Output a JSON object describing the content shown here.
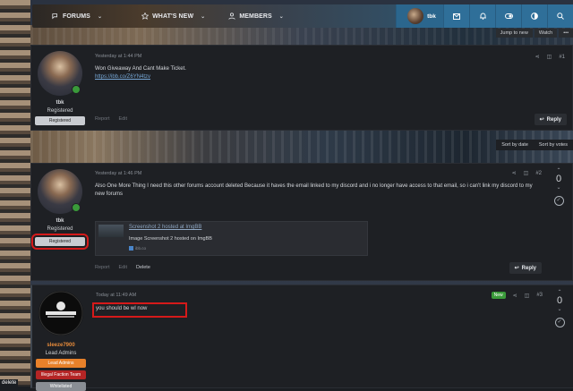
{
  "nav": {
    "items": [
      {
        "label": "FORUMS",
        "icon": "chat-bubbles-icon"
      },
      {
        "label": "WHAT'S NEW",
        "icon": "star-icon"
      },
      {
        "label": "MEMBERS",
        "icon": "person-icon"
      }
    ],
    "username": "tbk"
  },
  "thread_buttons": {
    "jump_to_new": "Jump to new",
    "watch": "Watch",
    "more": "•••"
  },
  "sort": {
    "by_date": "Sort by date",
    "by_votes": "Sort by votes"
  },
  "posts": [
    {
      "username": "tbk",
      "user_title": "Registered",
      "badges": [
        "Registered"
      ],
      "time": "Yesterday at 1:44 PM",
      "number": "#1",
      "text": "Won Giveaway And Cant Make Ticket.",
      "link": "https://ibb.co/Z6YN4tzv",
      "actions": [
        "Report",
        "Edit"
      ],
      "reply": "Reply"
    },
    {
      "username": "tbk",
      "user_title": "Registered",
      "badges": [
        "Registered"
      ],
      "time": "Yesterday at 1:46 PM",
      "number": "#2",
      "text": "Also One More Thing I need this other forums account deleted Because it haves the email linked to my discord and i no longer have access to that email, so i can't link my discord to my new forums",
      "embed": {
        "title": "Screenshot 2 hosted at ImgBB",
        "description": "Image Screenshot 2 hosted on ImgBB",
        "site": "ibb.co"
      },
      "actions": [
        "Report",
        "Edit",
        "Delete"
      ],
      "reply": "Reply",
      "votes": "0"
    },
    {
      "username": "sleeze7900",
      "user_title": "Lead Admins",
      "badges": [
        "Lead Admins",
        "Illegal Faction Team",
        "Whitelisted"
      ],
      "time": "Today at 11:49 AM",
      "number": "#3",
      "new_label": "New",
      "text": "you should be wl now",
      "votes": "0"
    }
  ],
  "footer_label": "delete",
  "colors": {
    "accent": "#2f6f99",
    "highlight_box": "#d51a1a",
    "online": "#3a9a3a",
    "badge_lead_admins": "#e8812a",
    "badge_illegal_faction": "#b42525",
    "badge_whitelisted": "#8a8e94",
    "sleeze_name": "#e58a3a"
  }
}
